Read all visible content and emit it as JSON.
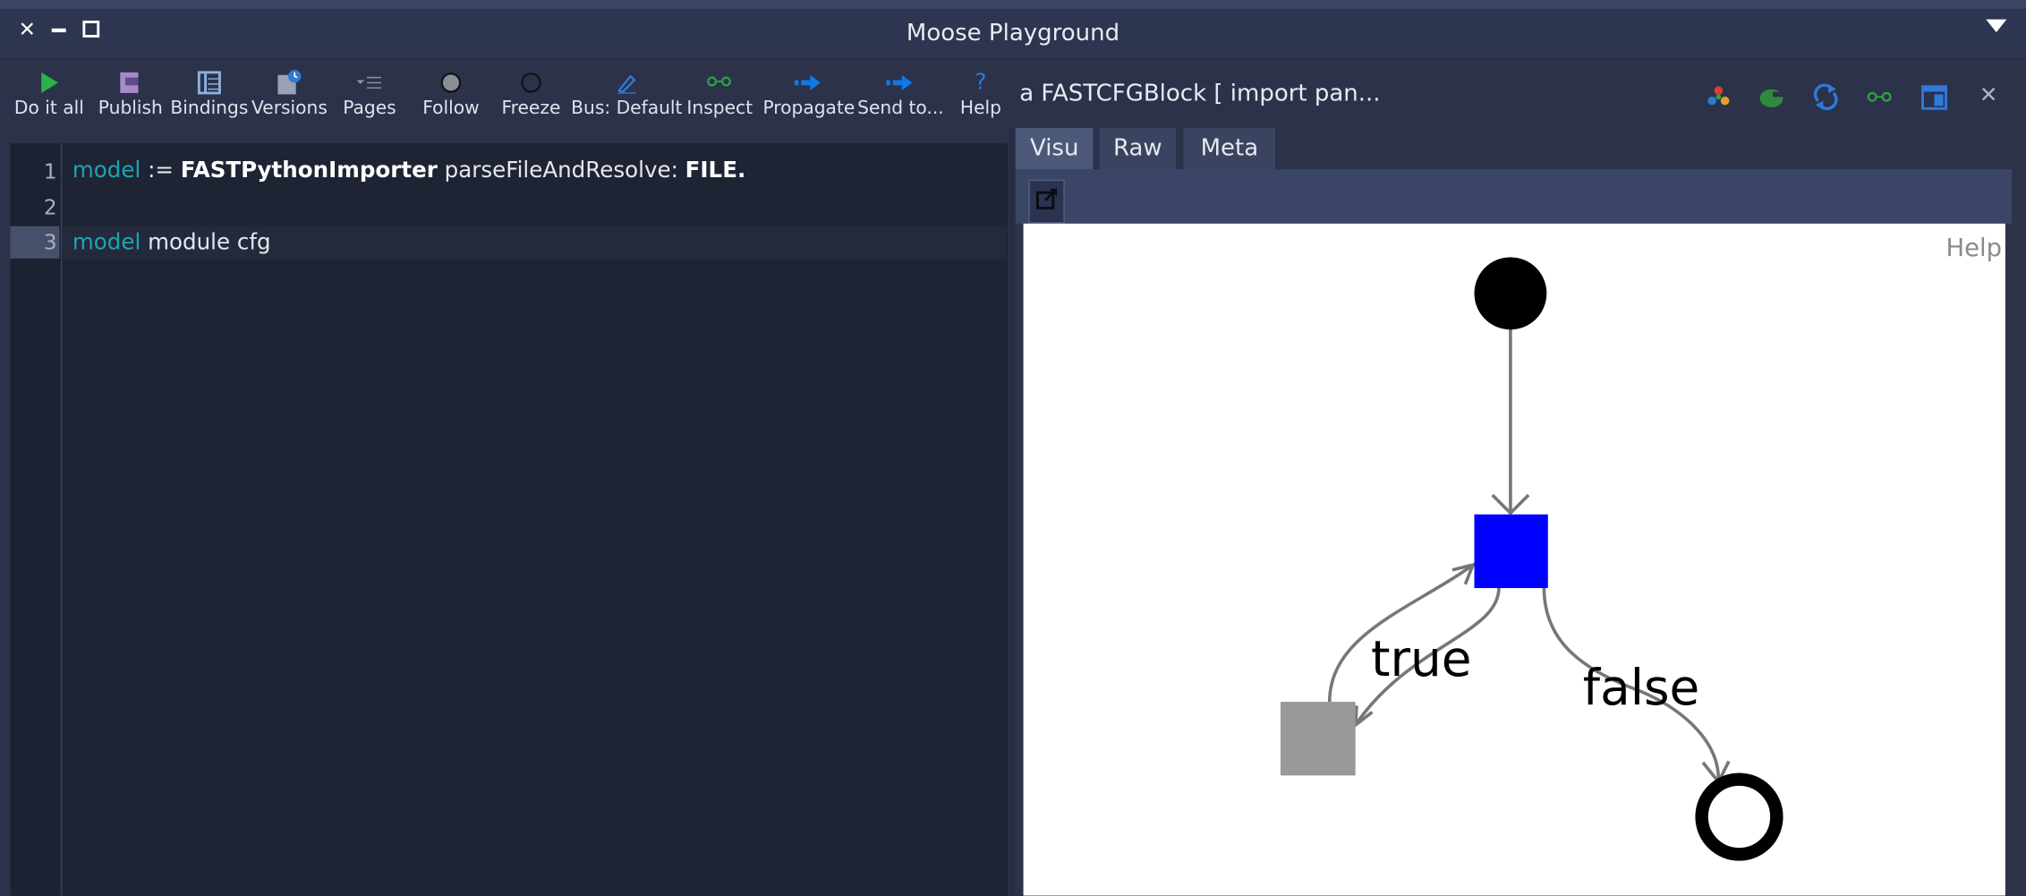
{
  "window": {
    "title": "Moose Playground"
  },
  "toolbar": {
    "items": [
      {
        "label": "Do it all",
        "icon": "play-icon"
      },
      {
        "label": "Publish",
        "icon": "publish-icon"
      },
      {
        "label": "Bindings",
        "icon": "bindings-icon"
      },
      {
        "label": "Versions",
        "icon": "versions-icon"
      },
      {
        "label": "Pages",
        "icon": "pages-icon"
      },
      {
        "label": "Follow",
        "icon": "follow-icon"
      },
      {
        "label": "Freeze",
        "icon": "freeze-icon"
      },
      {
        "label": "Bus: Default",
        "icon": "bus-icon"
      },
      {
        "label": "Inspect",
        "icon": "inspect-icon"
      },
      {
        "label": "Propagate",
        "icon": "propagate-icon"
      },
      {
        "label": "Send to...",
        "icon": "send-icon"
      },
      {
        "label": "Help",
        "icon": "help-icon"
      }
    ]
  },
  "editor": {
    "line_numbers": [
      "1",
      "2",
      "3"
    ],
    "lines": [
      {
        "var": "model",
        "assign": " := ",
        "cls": "FASTPythonImporter",
        "sel": " parseFileAndResolve: ",
        "arg": "FILE."
      },
      {
        "var": "model",
        "rest": " module cfg"
      }
    ]
  },
  "inspector": {
    "title": "a FASTCFGBlock [ import pan...",
    "tabs": [
      "Visu",
      "Raw",
      "Meta"
    ],
    "active_tab": "Visu",
    "canvas_help": "Help",
    "graph": {
      "edge_labels": {
        "true": "true",
        "false": "false"
      },
      "node_colors": {
        "entry": "#000000",
        "block": "#0000ff",
        "loop_block": "#999999",
        "exit": "#000000"
      }
    }
  },
  "colors": {
    "keyword": "#1fa3b4",
    "accent_blue": "#0077ff",
    "background": "#2b324a"
  }
}
